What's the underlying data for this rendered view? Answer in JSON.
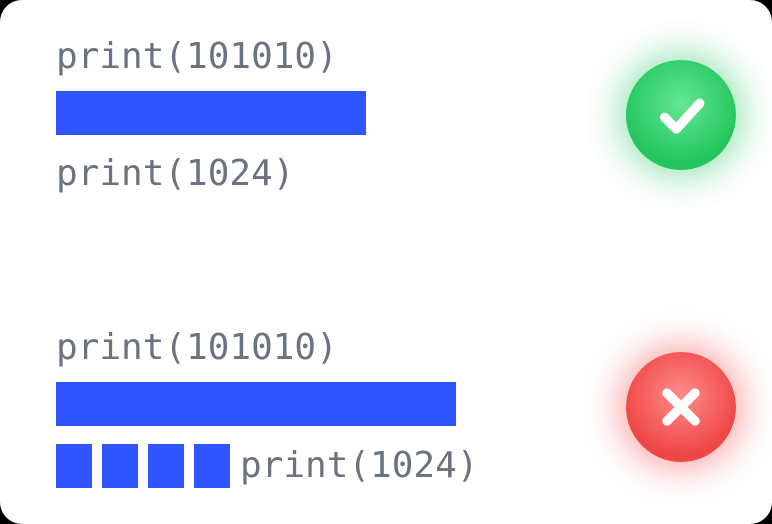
{
  "examples": {
    "good": {
      "line1": "print(101010)",
      "line3": "print(1024)"
    },
    "bad": {
      "line1": "print(101010)",
      "line3_suffix": "print(1024)"
    }
  },
  "colors": {
    "highlight": "#2f55ff",
    "good": "#22c55e",
    "bad": "#ef4545",
    "code_text": "#6b7280"
  }
}
